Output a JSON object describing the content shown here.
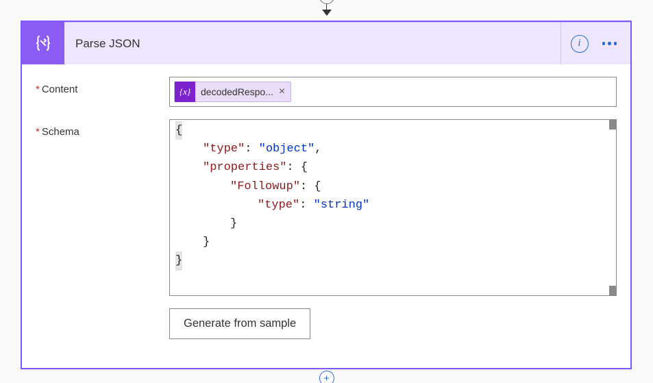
{
  "action": {
    "title": "Parse JSON"
  },
  "fields": {
    "content": {
      "label": "Content",
      "token": "decodedRespo..."
    },
    "schema": {
      "label": "Schema",
      "code": {
        "l1": "{",
        "l2_key": "\"type\"",
        "l2_val": "\"object\"",
        "l3_key": "\"properties\"",
        "l4_key": "\"Followup\"",
        "l5_key": "\"type\"",
        "l5_val": "\"string\"",
        "l6": "}",
        "l7": "}",
        "l8": "}"
      }
    }
  },
  "buttons": {
    "generate": "Generate from sample"
  }
}
